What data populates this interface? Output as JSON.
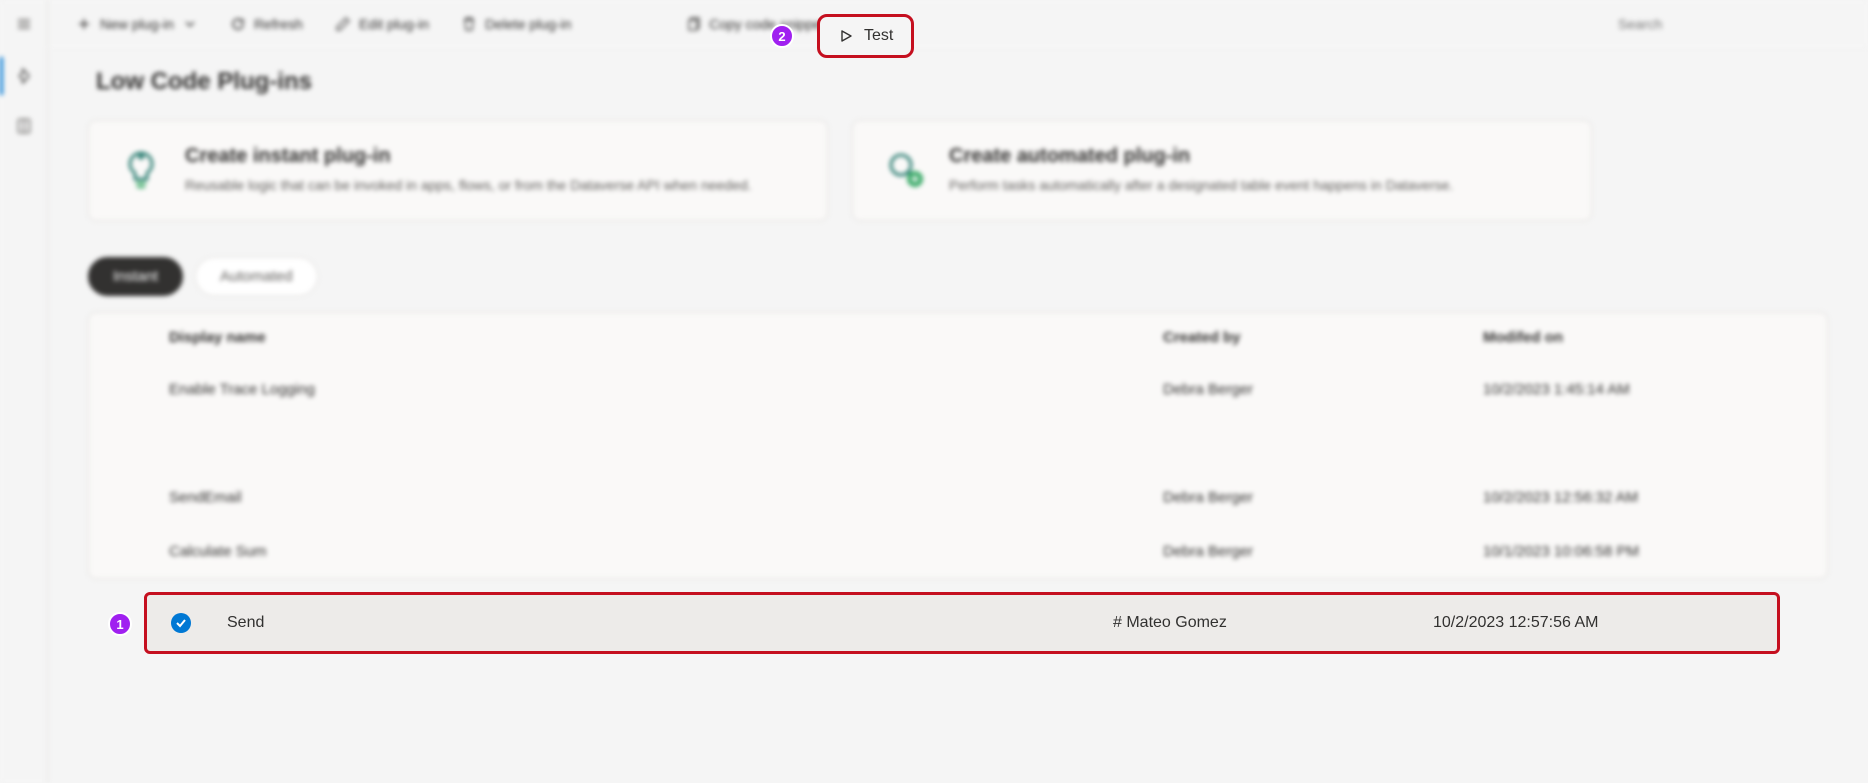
{
  "toolbar": {
    "new_plugin": "New plug-in",
    "refresh": "Refresh",
    "edit": "Edit plug-in",
    "delete": "Delete plug-in",
    "test": "Test",
    "copy": "Copy code snippet",
    "search_placeholder": "Search"
  },
  "page": {
    "title": "Low Code Plug-ins"
  },
  "cards": {
    "instant": {
      "title": "Create instant plug-in",
      "desc": "Reusable logic that can be invoked in apps, flows, or from the Dataverse API when needed."
    },
    "automated": {
      "title": "Create automated plug-in",
      "desc": "Perform tasks automatically after a designated table event happens in Dataverse."
    }
  },
  "tabs": {
    "instant": "Instant",
    "automated": "Automated"
  },
  "table": {
    "headers": {
      "display_name": "Display name",
      "created_by": "Created by",
      "modified_on": "Modifed on"
    },
    "rows": [
      {
        "name": "Enable Trace Logging",
        "created": "Debra Berger",
        "modified": "10/2/2023 1:45:14 AM",
        "selected": false
      },
      {
        "name": "Send",
        "created": "# Mateo Gomez",
        "modified": "10/2/2023 12:57:56 AM",
        "selected": true
      },
      {
        "name": "SendEmail",
        "created": "Debra Berger",
        "modified": "10/2/2023 12:56:32 AM",
        "selected": false
      },
      {
        "name": "Calculate Sum",
        "created": "Debra Berger",
        "modified": "10/1/2023 10:06:58 PM",
        "selected": false
      }
    ]
  },
  "annotations": {
    "one": "1",
    "two": "2"
  }
}
